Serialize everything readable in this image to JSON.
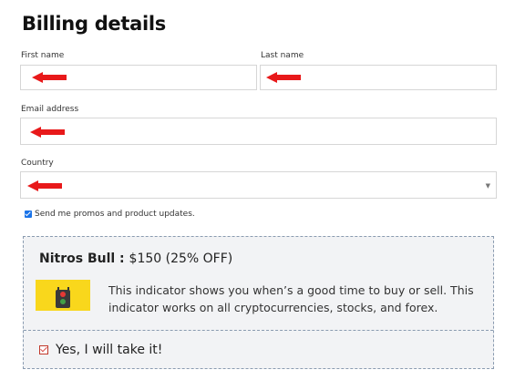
{
  "heading": "Billing details",
  "fields": {
    "first_name": {
      "label": "First name",
      "value": ""
    },
    "last_name": {
      "label": "Last name",
      "value": ""
    },
    "email": {
      "label": "Email address",
      "value": ""
    },
    "country": {
      "label": "Country",
      "value": ""
    }
  },
  "promos": {
    "label": "Send me promos and product updates.",
    "checked": true
  },
  "offer": {
    "title": "Nitros Bull :",
    "price": "$150 (25% OFF)",
    "description": "This indicator shows you when’s a good time to buy or sell. This indicator works on all cryptocurrencies, stocks, and forex.",
    "accept_label": "Yes, I will take it!",
    "accept_checked": true
  },
  "colors": {
    "accent": "#1a73e8",
    "annotation_arrow": "#e8191a",
    "offer_bg": "#f2f3f5",
    "image_bg": "#f9d71c"
  }
}
